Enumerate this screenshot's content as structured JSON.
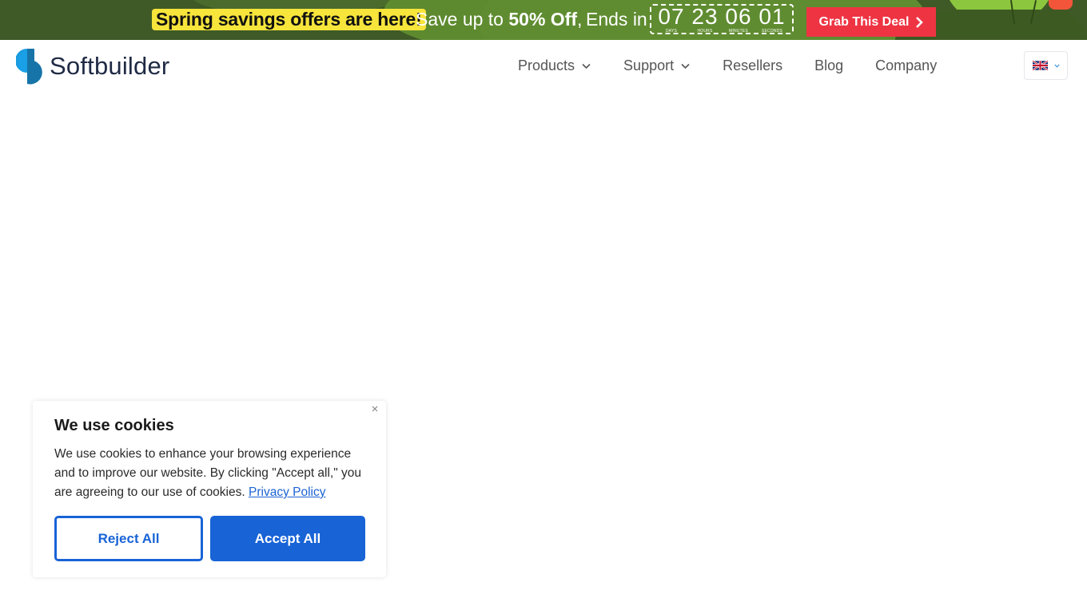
{
  "promo": {
    "highlight": "Spring savings offers are here!",
    "save_prefix": "Save up to ",
    "save_amount": "50% Off",
    "save_suffix": ",",
    "ends_in": "Ends in",
    "countdown": [
      {
        "value": "07",
        "label": "DAYS"
      },
      {
        "value": "23",
        "label": "HOURS"
      },
      {
        "value": "06",
        "label": "MINUTES"
      },
      {
        "value": "01",
        "label": "SECONDS"
      }
    ],
    "cta_label": "Grab This Deal",
    "colors": {
      "highlight": "#f7e53b",
      "cta": "#ee3443",
      "background": "#3f5a26"
    }
  },
  "header": {
    "brand": "Softbuilder",
    "nav": [
      {
        "label": "Products",
        "has_dropdown": true
      },
      {
        "label": "Support",
        "has_dropdown": true
      },
      {
        "label": "Resellers",
        "has_dropdown": false
      },
      {
        "label": "Blog",
        "has_dropdown": false
      },
      {
        "label": "Company",
        "has_dropdown": false
      }
    ],
    "language": {
      "icon": "uk-flag-icon",
      "selected": "English"
    }
  },
  "cookie_banner": {
    "title": "We use cookies",
    "body": "We use cookies to enhance your browsing experience and to improve our website. By clicking \"Accept all,\" you are agreeing to our use of cookies.",
    "privacy_link": "Privacy Policy",
    "reject_label": "Reject All",
    "accept_label": "Accept All",
    "colors": {
      "primary": "#1863d6"
    }
  }
}
